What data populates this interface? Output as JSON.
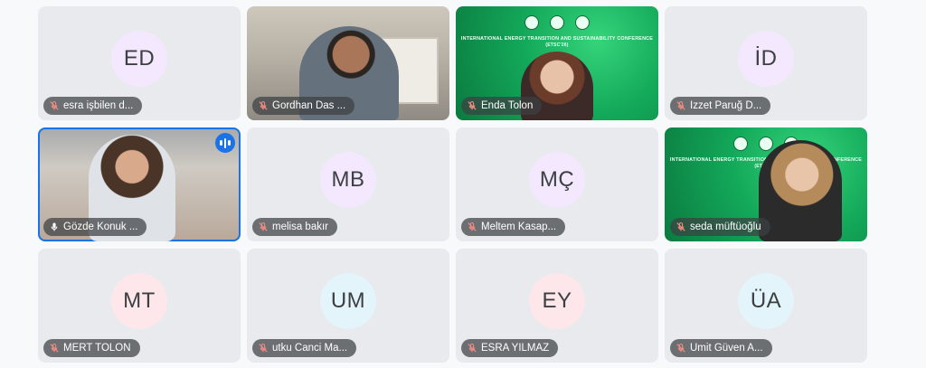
{
  "participants": [
    {
      "initials": "ED",
      "name": "esra işbilen d...",
      "avatar_color": "#f3e8fd",
      "mic": "muted",
      "video": false
    },
    {
      "initials": "",
      "name": "Gordhan Das ...",
      "mic": "muted",
      "video": true,
      "scene": "vid1"
    },
    {
      "initials": "",
      "name": "Enda Tolon",
      "mic": "muted",
      "video": true,
      "scene": "vid2",
      "banner_title": "INTERNATIONAL ENERGY TRANSITION AND SUSTAINABILITY CONFERENCE",
      "banner_sub": "(ETSC'26)"
    },
    {
      "initials": "İD",
      "name": "İzzet Paruğ D...",
      "avatar_color": "#f3e8fd",
      "mic": "muted",
      "video": false
    },
    {
      "initials": "",
      "name": "Gözde Konuk ...",
      "mic": "on",
      "video": true,
      "scene": "vid4",
      "speaking": true
    },
    {
      "initials": "MB",
      "name": "melisa bakır",
      "avatar_color": "#f3e8fd",
      "mic": "muted",
      "video": false
    },
    {
      "initials": "MÇ",
      "name": "Meltem Kasap...",
      "avatar_color": "#f3e8fd",
      "mic": "muted",
      "video": false
    },
    {
      "initials": "",
      "name": "seda müftüoğlu",
      "mic": "muted",
      "video": true,
      "scene": "vid3",
      "banner_title": "INTERNATIONAL ENERGY TRANSITION AND SUSTAINABILITY CONFERENCE",
      "banner_sub": "(ETSC'26)"
    },
    {
      "initials": "MT",
      "name": "MERT TOLON",
      "avatar_color": "#fde7ea",
      "mic": "muted",
      "video": false
    },
    {
      "initials": "UM",
      "name": "utku Canci Ma...",
      "avatar_color": "#e3f4fb",
      "mic": "muted",
      "video": false
    },
    {
      "initials": "EY",
      "name": "ESRA YILMAZ",
      "avatar_color": "#fde7ea",
      "mic": "muted",
      "video": false
    },
    {
      "initials": "ÜA",
      "name": "Ümit Güven A...",
      "avatar_color": "#e3f4fb",
      "mic": "muted",
      "video": false
    }
  ],
  "icons": {
    "muted": "mic-off-icon",
    "on": "mic-icon",
    "speaking": "speaking-indicator-icon"
  },
  "colors": {
    "tile_bg": "#e8eaed",
    "accent": "#1a73e8",
    "label_bg": "#3c4043"
  }
}
